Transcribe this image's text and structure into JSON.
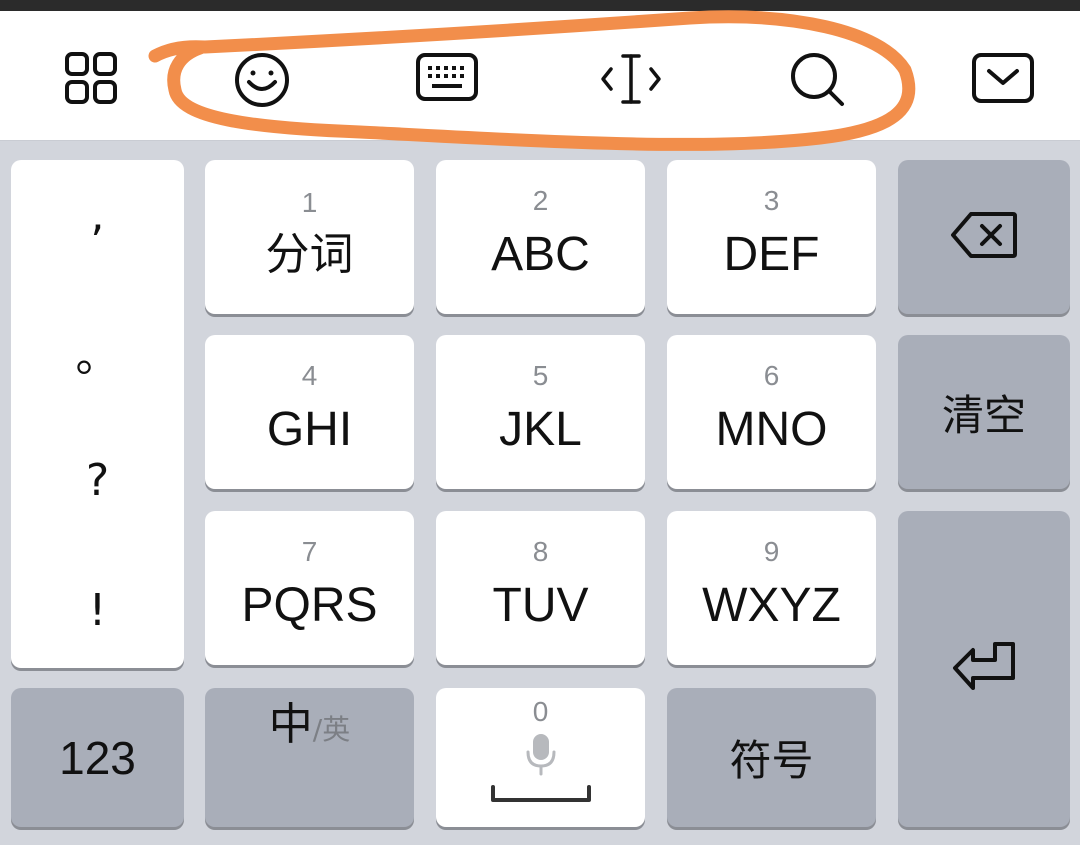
{
  "keys": {
    "k1": {
      "num": "1",
      "label": "分词"
    },
    "k2": {
      "num": "2",
      "label": "ABC"
    },
    "k3": {
      "num": "3",
      "label": "DEF"
    },
    "k4": {
      "num": "4",
      "label": "GHI"
    },
    "k5": {
      "num": "5",
      "label": "JKL"
    },
    "k6": {
      "num": "6",
      "label": "MNO"
    },
    "k7": {
      "num": "7",
      "label": "PQRS"
    },
    "k8": {
      "num": "8",
      "label": "TUV"
    },
    "k9": {
      "num": "9",
      "label": "WXYZ"
    },
    "k0": {
      "num": "0"
    }
  },
  "punctuation": [
    ",",
    "。",
    "?",
    "!"
  ],
  "right": {
    "clear_label": "清空"
  },
  "bottom": {
    "num_label": "123",
    "lang_main": "中",
    "lang_alt": "/英",
    "symbols_label": "符号"
  },
  "icons": {
    "apps": "grid-icon",
    "emoji": "emoji-icon",
    "keyboard": "keyboard-icon",
    "cursor": "cursor-move-icon",
    "search": "search-icon",
    "hide": "hide-keyboard-icon",
    "backspace": "backspace-icon",
    "enter": "enter-icon",
    "mic": "microphone-icon",
    "space": "space-icon"
  },
  "colors": {
    "annotation": "#f28e4b",
    "key_light": "#ffffff",
    "key_dark": "#a9aeb9",
    "background": "#d2d5dc"
  }
}
